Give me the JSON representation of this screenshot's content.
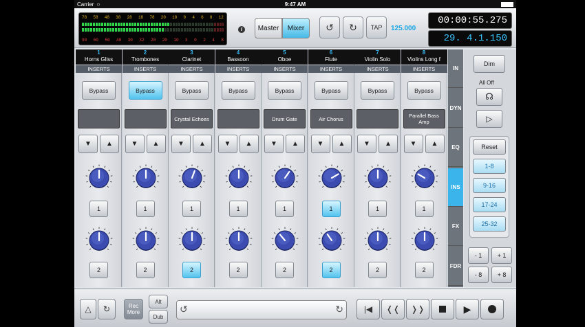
{
  "status_bar": {
    "carrier": "Carrier",
    "time": "9:47 AM"
  },
  "meter": {
    "scale_top": [
      "78",
      "58",
      "48",
      "38",
      "28",
      "18",
      "78",
      "20",
      "10",
      "0",
      "4",
      "6",
      "8",
      "12"
    ],
    "scale_bottom": [
      "90",
      "60",
      "50",
      "40",
      "30",
      "32",
      "28",
      "20",
      "10",
      "3",
      "0",
      "2",
      "4",
      "8"
    ],
    "level_left": 0.62,
    "level_right": 0.58
  },
  "header": {
    "master_label": "Master",
    "mixer_label": "Mixer",
    "tap_label": "TAP",
    "tempo": "125.000",
    "time_display": "00:00:55.275",
    "position_display": "29. 4.1.150"
  },
  "channels": [
    {
      "number": "1",
      "name": "Horns Gliss",
      "inserts": "INSERTS",
      "bypass": "Bypass",
      "bypass_on": false,
      "slot": "",
      "sel1": "1",
      "sel2": "2",
      "sel1_on": false,
      "sel2_on": false,
      "knob1_angle": 0,
      "knob2_angle": 0
    },
    {
      "number": "2",
      "name": "Trombones",
      "inserts": "INSERTS",
      "bypass": "Bypass",
      "bypass_on": true,
      "slot": "",
      "sel1": "1",
      "sel2": "2",
      "sel1_on": false,
      "sel2_on": false,
      "knob1_angle": 0,
      "knob2_angle": 0
    },
    {
      "number": "3",
      "name": "Clarinet",
      "inserts": "INSERTS",
      "bypass": "Bypass",
      "bypass_on": false,
      "slot": "Crystal Echoes",
      "sel1": "1",
      "sel2": "2",
      "sel1_on": false,
      "sel2_on": true,
      "knob1_angle": 20,
      "knob2_angle": 0
    },
    {
      "number": "4",
      "name": "Bassoon",
      "inserts": "INSERTS",
      "bypass": "Bypass",
      "bypass_on": false,
      "slot": "",
      "sel1": "1",
      "sel2": "2",
      "sel1_on": false,
      "sel2_on": false,
      "knob1_angle": 0,
      "knob2_angle": 0
    },
    {
      "number": "5",
      "name": "Oboe",
      "inserts": "INSERTS",
      "bypass": "Bypass",
      "bypass_on": false,
      "slot": "Drum Gate",
      "sel1": "1",
      "sel2": "2",
      "sel1_on": false,
      "sel2_on": false,
      "knob1_angle": 35,
      "knob2_angle": -40
    },
    {
      "number": "6",
      "name": "Flute",
      "inserts": "INSERTS",
      "bypass": "Bypass",
      "bypass_on": false,
      "slot": "Air Chorus",
      "sel1": "1",
      "sel2": "2",
      "sel1_on": true,
      "sel2_on": true,
      "knob1_angle": 60,
      "knob2_angle": -35
    },
    {
      "number": "7",
      "name": "Violin Solo",
      "inserts": "INSERTS",
      "bypass": "Bypass",
      "bypass_on": false,
      "slot": "",
      "sel1": "1",
      "sel2": "2",
      "sel1_on": false,
      "sel2_on": false,
      "knob1_angle": 0,
      "knob2_angle": 0
    },
    {
      "number": "8",
      "name": "Violins Long f",
      "inserts": "INSERTS",
      "bypass": "Bypass",
      "bypass_on": false,
      "slot": "Parallel Bass Amp",
      "sel1": "1",
      "sel2": "2",
      "sel1_on": false,
      "sel2_on": false,
      "knob1_angle": -60,
      "knob2_angle": 0
    }
  ],
  "tabs": [
    {
      "label": "IN",
      "active": false
    },
    {
      "label": "DYN",
      "active": false
    },
    {
      "label": "EQ",
      "active": false
    },
    {
      "label": "INS",
      "active": true
    },
    {
      "label": "FX",
      "active": false
    },
    {
      "label": "FDR",
      "active": false
    }
  ],
  "right_panel": {
    "dim_label": "Dim",
    "all_off_label": "All Off",
    "reset_label": "Reset",
    "banks": [
      "1-8",
      "9-16",
      "17-24",
      "25-32"
    ],
    "nudge": [
      "- 1",
      "+ 1",
      "- 8",
      "+ 8"
    ]
  },
  "bottom": {
    "rec_more": [
      "Rec",
      "More"
    ],
    "alt_label": "Alt",
    "dub_label": "Dub"
  },
  "colors": {
    "accent": "#3ab4ea",
    "knob": "#3b4bb0",
    "lcd_blue": "#38c6ff"
  },
  "icons": [
    "metronome-icon",
    "loop-icon",
    "headphones-icon",
    "speaker-icon",
    "undo-icon",
    "redo-icon",
    "rewind-to-start-icon",
    "rewind-icon",
    "fast-forward-icon",
    "stop-icon",
    "play-icon",
    "record-icon"
  ]
}
